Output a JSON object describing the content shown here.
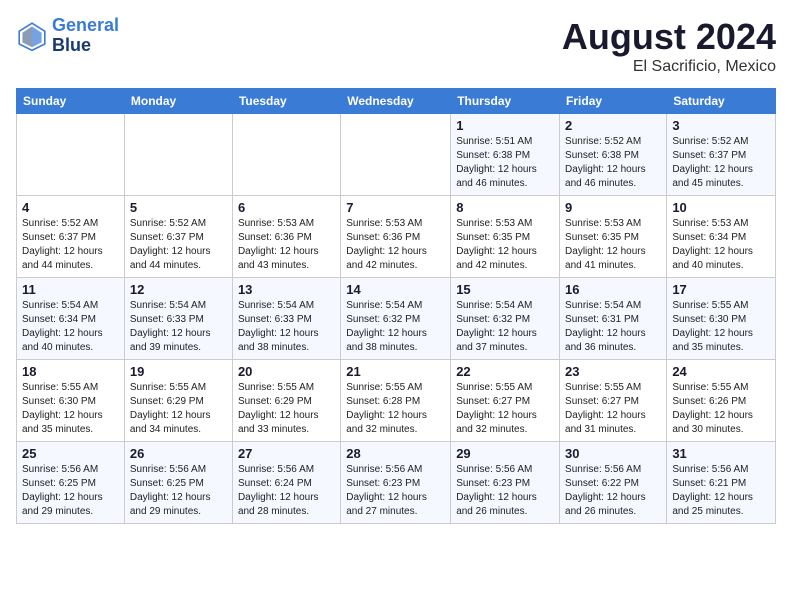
{
  "logo": {
    "line1": "General",
    "line2": "Blue"
  },
  "title": "August 2024",
  "subtitle": "El Sacrificio, Mexico",
  "days_of_week": [
    "Sunday",
    "Monday",
    "Tuesday",
    "Wednesday",
    "Thursday",
    "Friday",
    "Saturday"
  ],
  "weeks": [
    [
      {
        "day": "",
        "info": ""
      },
      {
        "day": "",
        "info": ""
      },
      {
        "day": "",
        "info": ""
      },
      {
        "day": "",
        "info": ""
      },
      {
        "day": "1",
        "info": "Sunrise: 5:51 AM\nSunset: 6:38 PM\nDaylight: 12 hours\nand 46 minutes."
      },
      {
        "day": "2",
        "info": "Sunrise: 5:52 AM\nSunset: 6:38 PM\nDaylight: 12 hours\nand 46 minutes."
      },
      {
        "day": "3",
        "info": "Sunrise: 5:52 AM\nSunset: 6:37 PM\nDaylight: 12 hours\nand 45 minutes."
      }
    ],
    [
      {
        "day": "4",
        "info": "Sunrise: 5:52 AM\nSunset: 6:37 PM\nDaylight: 12 hours\nand 44 minutes."
      },
      {
        "day": "5",
        "info": "Sunrise: 5:52 AM\nSunset: 6:37 PM\nDaylight: 12 hours\nand 44 minutes."
      },
      {
        "day": "6",
        "info": "Sunrise: 5:53 AM\nSunset: 6:36 PM\nDaylight: 12 hours\nand 43 minutes."
      },
      {
        "day": "7",
        "info": "Sunrise: 5:53 AM\nSunset: 6:36 PM\nDaylight: 12 hours\nand 42 minutes."
      },
      {
        "day": "8",
        "info": "Sunrise: 5:53 AM\nSunset: 6:35 PM\nDaylight: 12 hours\nand 42 minutes."
      },
      {
        "day": "9",
        "info": "Sunrise: 5:53 AM\nSunset: 6:35 PM\nDaylight: 12 hours\nand 41 minutes."
      },
      {
        "day": "10",
        "info": "Sunrise: 5:53 AM\nSunset: 6:34 PM\nDaylight: 12 hours\nand 40 minutes."
      }
    ],
    [
      {
        "day": "11",
        "info": "Sunrise: 5:54 AM\nSunset: 6:34 PM\nDaylight: 12 hours\nand 40 minutes."
      },
      {
        "day": "12",
        "info": "Sunrise: 5:54 AM\nSunset: 6:33 PM\nDaylight: 12 hours\nand 39 minutes."
      },
      {
        "day": "13",
        "info": "Sunrise: 5:54 AM\nSunset: 6:33 PM\nDaylight: 12 hours\nand 38 minutes."
      },
      {
        "day": "14",
        "info": "Sunrise: 5:54 AM\nSunset: 6:32 PM\nDaylight: 12 hours\nand 38 minutes."
      },
      {
        "day": "15",
        "info": "Sunrise: 5:54 AM\nSunset: 6:32 PM\nDaylight: 12 hours\nand 37 minutes."
      },
      {
        "day": "16",
        "info": "Sunrise: 5:54 AM\nSunset: 6:31 PM\nDaylight: 12 hours\nand 36 minutes."
      },
      {
        "day": "17",
        "info": "Sunrise: 5:55 AM\nSunset: 6:30 PM\nDaylight: 12 hours\nand 35 minutes."
      }
    ],
    [
      {
        "day": "18",
        "info": "Sunrise: 5:55 AM\nSunset: 6:30 PM\nDaylight: 12 hours\nand 35 minutes."
      },
      {
        "day": "19",
        "info": "Sunrise: 5:55 AM\nSunset: 6:29 PM\nDaylight: 12 hours\nand 34 minutes."
      },
      {
        "day": "20",
        "info": "Sunrise: 5:55 AM\nSunset: 6:29 PM\nDaylight: 12 hours\nand 33 minutes."
      },
      {
        "day": "21",
        "info": "Sunrise: 5:55 AM\nSunset: 6:28 PM\nDaylight: 12 hours\nand 32 minutes."
      },
      {
        "day": "22",
        "info": "Sunrise: 5:55 AM\nSunset: 6:27 PM\nDaylight: 12 hours\nand 32 minutes."
      },
      {
        "day": "23",
        "info": "Sunrise: 5:55 AM\nSunset: 6:27 PM\nDaylight: 12 hours\nand 31 minutes."
      },
      {
        "day": "24",
        "info": "Sunrise: 5:55 AM\nSunset: 6:26 PM\nDaylight: 12 hours\nand 30 minutes."
      }
    ],
    [
      {
        "day": "25",
        "info": "Sunrise: 5:56 AM\nSunset: 6:25 PM\nDaylight: 12 hours\nand 29 minutes."
      },
      {
        "day": "26",
        "info": "Sunrise: 5:56 AM\nSunset: 6:25 PM\nDaylight: 12 hours\nand 29 minutes."
      },
      {
        "day": "27",
        "info": "Sunrise: 5:56 AM\nSunset: 6:24 PM\nDaylight: 12 hours\nand 28 minutes."
      },
      {
        "day": "28",
        "info": "Sunrise: 5:56 AM\nSunset: 6:23 PM\nDaylight: 12 hours\nand 27 minutes."
      },
      {
        "day": "29",
        "info": "Sunrise: 5:56 AM\nSunset: 6:23 PM\nDaylight: 12 hours\nand 26 minutes."
      },
      {
        "day": "30",
        "info": "Sunrise: 5:56 AM\nSunset: 6:22 PM\nDaylight: 12 hours\nand 26 minutes."
      },
      {
        "day": "31",
        "info": "Sunrise: 5:56 AM\nSunset: 6:21 PM\nDaylight: 12 hours\nand 25 minutes."
      }
    ]
  ]
}
